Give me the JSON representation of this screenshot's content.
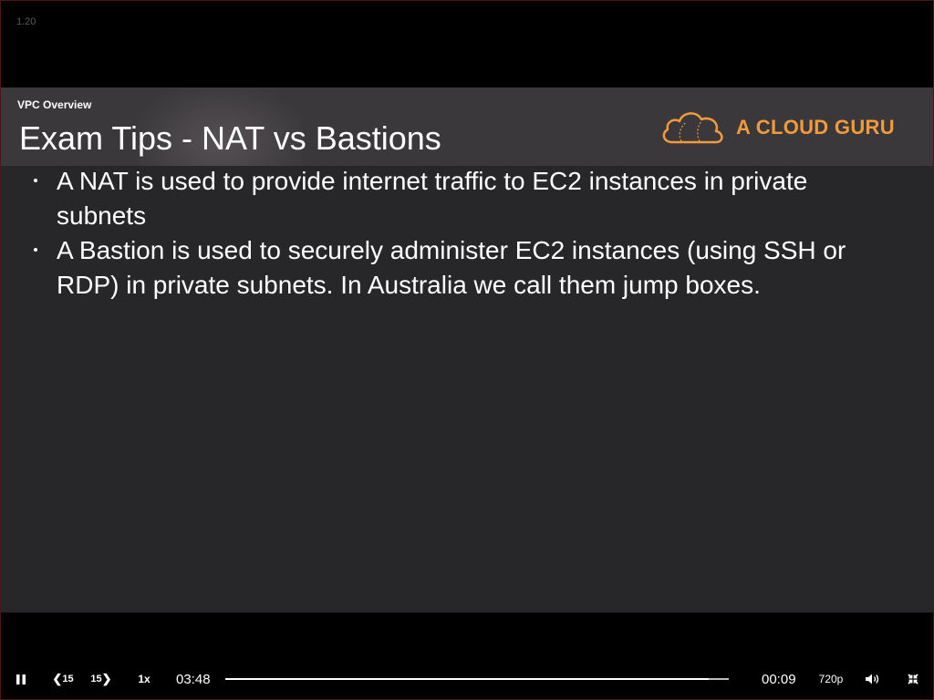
{
  "corner_label": "1.20",
  "slide": {
    "section": "VPC Overview",
    "title": "Exam Tips - NAT vs Bastions",
    "logo_text": "A CLOUD GURU",
    "bullets": [
      "A NAT is used to provide internet traffic to EC2 instances in private subnets",
      "A Bastion is used to securely administer EC2 instances (using SSH or RDP) in private subnets. In Australia we call them jump boxes."
    ]
  },
  "controls": {
    "pause_icon": "pause-icon",
    "rewind_label": "15",
    "forward_label": "15",
    "speed_label": "1x",
    "elapsed_time": "03:48",
    "remaining_time": "00:09",
    "quality_label": "720p",
    "volume_icon": "volume-icon",
    "exit_fullscreen_icon": "exit-fullscreen-icon",
    "progress_fraction": 0.96
  },
  "colors": {
    "accent": "#f19a3e",
    "slide_background": "#272629",
    "header_band": "#3a383b"
  }
}
